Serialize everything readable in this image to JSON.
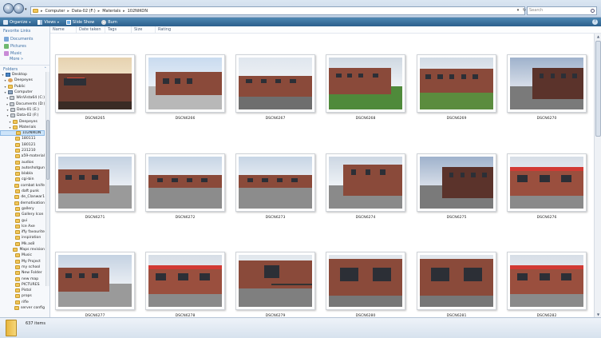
{
  "addressbar": {
    "crumbs": [
      "Computer",
      "Data-02 (F:)",
      "Materials",
      "102NIKON"
    ],
    "search_placeholder": "Search"
  },
  "toolbar": {
    "organize": "Organize",
    "views": "Views",
    "slideshow": "Slide Show",
    "burn": "Burn"
  },
  "navpane": {
    "favorite_links_header": "Favorite Links",
    "favorites": [
      "Documents",
      "Pictures",
      "Music"
    ],
    "more_label": "More",
    "folders_header": "Folders",
    "tree": [
      {
        "label": "Desktop",
        "icon": "desktop-icon",
        "indent": 0
      },
      {
        "label": "Deepeyes",
        "icon": "user-icon",
        "indent": 1
      },
      {
        "label": "Public",
        "icon": "folder-icon",
        "indent": 1
      },
      {
        "label": "Computer",
        "icon": "computer-icon",
        "indent": 1
      },
      {
        "label": "WinVista64 (C:)",
        "icon": "drive-icon",
        "indent": 2
      },
      {
        "label": "Documents (D:)",
        "icon": "drive-icon",
        "indent": 2
      },
      {
        "label": "Data-01 (E:)",
        "icon": "drive-icon",
        "indent": 2
      },
      {
        "label": "Data-02 (F:)",
        "icon": "drive-icon",
        "indent": 2
      },
      {
        "label": "Deepeyes",
        "icon": "folder-icon",
        "indent": 3
      },
      {
        "label": "Materials",
        "icon": "folder-icon",
        "indent": 3
      },
      {
        "label": "102NIKON",
        "icon": "folder-icon",
        "indent": 4,
        "selected": true
      },
      {
        "label": "180111",
        "icon": "folder-icon",
        "indent": 4
      },
      {
        "label": "180121",
        "icon": "folder-icon",
        "indent": 4
      },
      {
        "label": "231210",
        "icon": "folder-icon",
        "indent": 4
      },
      {
        "label": "a59-material",
        "icon": "folder-icon",
        "indent": 4
      },
      {
        "label": "audios",
        "icon": "folder-icon",
        "indent": 4
      },
      {
        "label": "autoshotgun",
        "icon": "folder-icon",
        "indent": 4
      },
      {
        "label": "blabla",
        "icon": "folder-icon",
        "indent": 4
      },
      {
        "label": "cgi-bin",
        "icon": "folder-icon",
        "indent": 4
      },
      {
        "label": "combat knife",
        "icon": "folder-icon",
        "indent": 4
      },
      {
        "label": "daft punk",
        "icon": "folder-icon",
        "indent": 4
      },
      {
        "label": "de_Clanwar1",
        "icon": "folder-icon",
        "indent": 4
      },
      {
        "label": "demotivation",
        "icon": "folder-icon",
        "indent": 4
      },
      {
        "label": "gallery",
        "icon": "folder-icon",
        "indent": 4
      },
      {
        "label": "Gallery Icon",
        "icon": "folder-icon",
        "indent": 4
      },
      {
        "label": "gui",
        "icon": "folder-icon",
        "indent": 4
      },
      {
        "label": "Ice Axe",
        "icon": "folder-icon",
        "indent": 4
      },
      {
        "label": "iffy favourite",
        "icon": "folder-icon",
        "indent": 4
      },
      {
        "label": "inspiration",
        "icon": "folder-icon",
        "indent": 4
      },
      {
        "label": "Mk.as8",
        "icon": "folder-icon",
        "indent": 4
      },
      {
        "label": "Maps revision",
        "icon": "folder-icon",
        "indent": 4
      },
      {
        "label": "Music",
        "icon": "folder-icon",
        "indent": 4
      },
      {
        "label": "My Project",
        "icon": "folder-icon",
        "indent": 4
      },
      {
        "label": "my school",
        "icon": "folder-icon",
        "indent": 4
      },
      {
        "label": "New Folder",
        "icon": "folder-icon",
        "indent": 4
      },
      {
        "label": "new map",
        "icon": "folder-icon",
        "indent": 4
      },
      {
        "label": "PICTURES",
        "icon": "folder-icon",
        "indent": 4
      },
      {
        "label": "Pistol",
        "icon": "folder-icon",
        "indent": 4
      },
      {
        "label": "props",
        "icon": "folder-icon",
        "indent": 4
      },
      {
        "label": "rifle",
        "icon": "folder-icon",
        "indent": 4
      },
      {
        "label": "server config",
        "icon": "folder-icon",
        "indent": 4
      }
    ]
  },
  "columns": [
    "Name",
    "Date taken",
    "Tags",
    "Size",
    "Rating"
  ],
  "files": [
    {
      "name": "DSCN6265",
      "scene": "sunset-sign"
    },
    {
      "name": "DSCN6266",
      "scene": "building-path"
    },
    {
      "name": "DSCN6267",
      "scene": "building-tree"
    },
    {
      "name": "DSCN6268",
      "scene": "building-lawn"
    },
    {
      "name": "DSCN6269",
      "scene": "building-grass"
    },
    {
      "name": "DSCN6270",
      "scene": "building-dusk"
    },
    {
      "name": "DSCN6271",
      "scene": "building-lot"
    },
    {
      "name": "DSCN6272",
      "scene": "courtyard"
    },
    {
      "name": "DSCN6273",
      "scene": "courtyard"
    },
    {
      "name": "DSCN6274",
      "scene": "corner"
    },
    {
      "name": "DSCN6275",
      "scene": "building-dusk"
    },
    {
      "name": "DSCN6276",
      "scene": "red-front"
    },
    {
      "name": "DSCN6277",
      "scene": "building-lot"
    },
    {
      "name": "DSCN6278",
      "scene": "red-front"
    },
    {
      "name": "DSCN6279",
      "scene": "ramp"
    },
    {
      "name": "DSCN6280",
      "scene": "wall-windows"
    },
    {
      "name": "DSCN6281",
      "scene": "wall-windows"
    },
    {
      "name": "DSCN6282",
      "scene": "red-front"
    }
  ],
  "status": {
    "item_count": "637 items"
  },
  "colors": {
    "toolbar": "#2b5f8c",
    "selection": "#cde4f9",
    "brick": "#8a4a3a"
  }
}
